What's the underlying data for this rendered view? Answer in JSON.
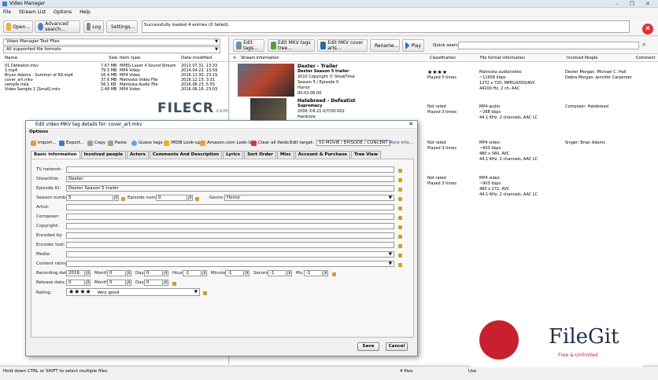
{
  "window": {
    "title": "Video Manager",
    "controls": "– ❐ ✕"
  },
  "menu": [
    "File",
    "Stream List",
    "Options",
    "Help"
  ],
  "toolbar": {
    "open": "Open...",
    "advanced_search": "Advanced search...",
    "log": "Log",
    "settings": "Settings...",
    "status_message": "Successfully loaded 4 entries (0 failed)."
  },
  "left": {
    "library_selector": "Video Manager Test Files",
    "format_filter": "All supported file formats",
    "columns": {
      "name": "Name",
      "size": "Size",
      "item_type": "Item type",
      "date_modified": "Date modified"
    },
    "files": [
      {
        "name": "01 Defeatist.mkv",
        "size": "7.67 MB",
        "type": "MPEG Layer 4 Sound Stream",
        "date": "2013.07.31. 13:33"
      },
      {
        "name": "1.mp4",
        "size": "79.5 MB",
        "type": "MP4 Video",
        "date": "2014.04.22. 13:59"
      },
      {
        "name": "Bryan Adams - Summer of 69.mp4",
        "size": "16.4 MB",
        "type": "MP4 Video",
        "date": "2016.11.30. 23:19"
      },
      {
        "name": "cover_art.mkv",
        "size": "37.6 MB",
        "type": "Matroska Video File",
        "date": "2016.12.15. 3:31"
      },
      {
        "name": "sample.mka",
        "size": "56.1 KB",
        "type": "Matroska Audio File",
        "date": "2016.06.23. 5:55"
      },
      {
        "name": "Video Sample 1 [Small].mkv",
        "size": "2.48 MB",
        "type": "MP4 Video",
        "date": "2016.06.16. 23:03"
      }
    ]
  },
  "right": {
    "edit_tags": "Edit tags...",
    "edit_mkv_tags_tree": "Edit MKV tags tree...",
    "edit_mkv_cover_arts": "Edit MKV cover arts...",
    "rename": "Rename...",
    "play": "Play",
    "quick_search_label": "Quick search:",
    "columns": {
      "stream_info": "Stream information",
      "classification": "Classification",
      "file_format": "File format information",
      "involved": "Involved People",
      "comment": "Comment"
    },
    "entries": [
      {
        "title": "Dexter - Trailer",
        "lines": [
          "Dexter Season 5 trailer",
          "2010 Copyright © ShowTime",
          "Season 5 / Episode 0",
          "Horror",
          "00:02:06.00"
        ],
        "rating": "★★★★",
        "played": "Played 5 times",
        "format": [
          "Matroska audio/video",
          "~11658 kbps",
          "1272 x 720, MPEG4/ISO/AVC",
          "44100 Hz, 2 ch, AAC"
        ],
        "people": [
          "Dexter Morgan: Michael C. Hall",
          "Debra Morgan: Jennifer Carpenter"
        ]
      },
      {
        "title": "Hatebreed - Defeatist",
        "lines": [
          "Supremacy",
          "2006 ©8.21 0/7(00-002",
          "Hardcore"
        ],
        "rating": "Not rated",
        "played": "Played 3 times",
        "format": [
          "MP4 audio",
          "~268 kbps",
          "44.1 KHz, 2 channels, AAC LC"
        ],
        "people": [
          "Composer: Hatebreed"
        ]
      },
      {
        "title": "",
        "lines": [],
        "rating": "Not rated",
        "played": "Played 3 times",
        "format": [
          "MP4 video",
          "~603 kbps",
          "480 x 360, AVC",
          "44.1 KHz, 2 channels, AAC LC"
        ],
        "people": [
          "Singer: Brian Adams"
        ]
      },
      {
        "title": "",
        "lines": [],
        "rating": "Not rated",
        "played": "Played 3 times",
        "format": [
          "MP4 video",
          "~903 kbps",
          "480 x 272, AVC",
          "44.1 KHz, 2 channels, AAC LC"
        ],
        "people": []
      }
    ]
  },
  "statusbar": {
    "hint": "Hold down CTRL or SHIFT to select multiple files.",
    "count": "4 files",
    "trailing": "Use"
  },
  "dialog": {
    "title": "Edit video MKV tag details for: cover_art.mkv",
    "options_label": "Options",
    "buttons": {
      "import": "Import...",
      "export": "Export...",
      "copy": "Copy",
      "paste": "Paste",
      "guess": "Guess tags",
      "imdb": "IMDB Look-up...",
      "amazon": "Amazon.com Look-Up...",
      "clear": "Clear all fields",
      "edit_target_label": "Edit target:",
      "edit_target": "50 MOVIE / EPISODE / CONCERT",
      "more_info": "More info..."
    },
    "tabs": [
      "Basic information",
      "Involved people",
      "Actors",
      "Comments And Description",
      "Lyrics",
      "Sort Order",
      "Misc",
      "Account & Purchase",
      "Tree View"
    ],
    "fields": {
      "tv_network": {
        "label": "TV network:",
        "value": ""
      },
      "show_title": {
        "label": "Show/title:",
        "value": "Dexter"
      },
      "episode_id": {
        "label": "Episode ID:",
        "value": "Dexter Season 5 trailer"
      },
      "season_number": {
        "label": "Season number:",
        "value": "5"
      },
      "episode_number": {
        "label": "Episode number:",
        "value": "0"
      },
      "genre": {
        "label": "Genre:",
        "value": "Horror"
      },
      "artist": {
        "label": "Artist:",
        "value": ""
      },
      "composer": {
        "label": "Composer:",
        "value": ""
      },
      "copyright": {
        "label": "Copyright:",
        "value": ""
      },
      "encoded_by": {
        "label": "Encoded by:",
        "value": ""
      },
      "encoder_tool": {
        "label": "Encoder tool:",
        "value": ""
      },
      "media": {
        "label": "Media:",
        "value": ""
      },
      "content_rating": {
        "label": "Content rating:",
        "value": ""
      },
      "recording_date": {
        "label": "Recording date:",
        "year": "2016",
        "month_label": "Month:",
        "month": "0",
        "day_label": "Day:",
        "day": "0",
        "hour_label": "Hour:",
        "hour": "-1",
        "minute_label": "Minute:",
        "minute": "-1",
        "second_label": "Second:",
        "second": "-1",
        "ms_label": "Ms:",
        "ms": "-1"
      },
      "release_date": {
        "label": "Release date:",
        "year": "0",
        "month_label": "Month:",
        "month": "0",
        "day_label": "Day:",
        "day": "0"
      },
      "rating": {
        "label": "Rating:",
        "stars": "★★★★",
        "value": "Very good"
      }
    },
    "save": "Save",
    "cancel": "Cancel"
  },
  "watermarks": {
    "filecr": "FILECR",
    "filecr_sub": ".com",
    "filegit": "FileGit",
    "filegit_tag": "Free & Unlimited"
  }
}
